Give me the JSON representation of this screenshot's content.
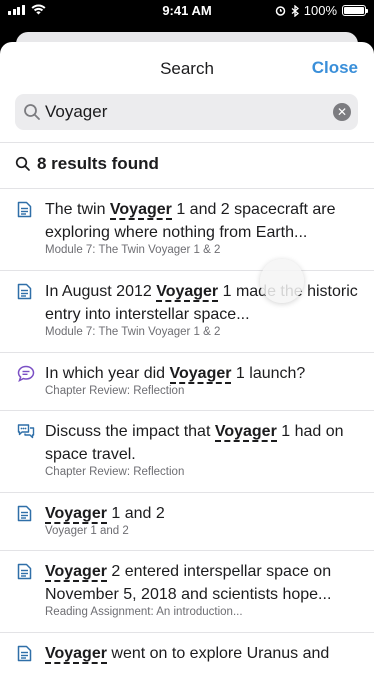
{
  "status": {
    "time": "9:41 AM",
    "battery": "100%"
  },
  "header": {
    "title": "Search",
    "close_label": "Close"
  },
  "search": {
    "value": "Voyager",
    "clear_icon": "clear-icon"
  },
  "results_count": "8 results found",
  "results": [
    {
      "icon": "document-icon",
      "pre": "The twin ",
      "hl": "Voyager",
      "post": " 1 and 2 spacecraft are exploring where nothing from Earth...",
      "source": "Module 7: The Twin Voyager 1 & 2"
    },
    {
      "icon": "document-icon",
      "pre": "In August 2012 ",
      "hl": "Voyager",
      "post": " 1 made the historic entry into interstellar space...",
      "source": "Module 7: The Twin Voyager 1 & 2"
    },
    {
      "icon": "question-bubble-icon",
      "pre": "In which year did ",
      "hl": "Voyager",
      "post": " 1 launch?",
      "source": "Chapter Review: Reflection"
    },
    {
      "icon": "discussion-bubbles-icon",
      "pre": "Discuss the impact that ",
      "hl": "Voyager",
      "post": " 1 had on space travel.",
      "source": "Chapter Review: Reflection"
    },
    {
      "icon": "document-icon",
      "pre": "",
      "hl": "Voyager",
      "post": " 1 and 2",
      "source": "Voyager 1 and 2"
    },
    {
      "icon": "document-icon",
      "pre": "",
      "hl": "Voyager",
      "post": " 2 entered interspellar space on November 5, 2018 and scientists hope...",
      "source": "Reading Assignment: An introduction..."
    },
    {
      "icon": "document-icon",
      "pre": "",
      "hl": "Voyager",
      "post": " went on to explore Uranus and",
      "source": ""
    }
  ],
  "colors": {
    "accent": "#3a8fd9",
    "question_icon": "#7a4fc4",
    "icon_blue": "#2f6fa8"
  }
}
